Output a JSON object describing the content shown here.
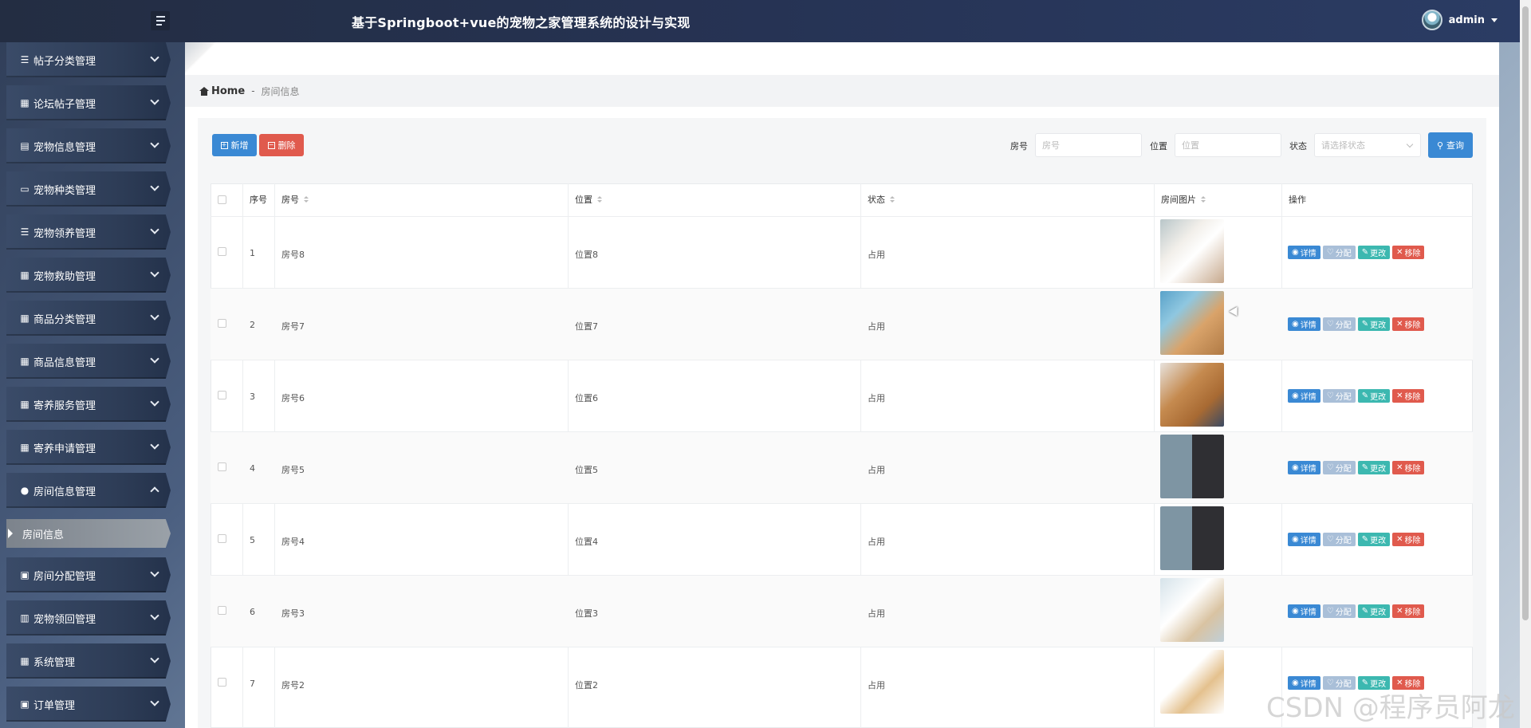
{
  "header": {
    "title": "基于Springboot+vue的宠物之家管理系统的设计与实现",
    "user": "admin"
  },
  "sidebar": {
    "items": [
      {
        "label": "帖子分类管理",
        "icon": "list-icon"
      },
      {
        "label": "论坛帖子管理",
        "icon": "grid-icon"
      },
      {
        "label": "宠物信息管理",
        "icon": "chat-icon"
      },
      {
        "label": "宠物种类管理",
        "icon": "monitor-icon"
      },
      {
        "label": "宠物领养管理",
        "icon": "list-icon"
      },
      {
        "label": "宠物救助管理",
        "icon": "grid-icon"
      },
      {
        "label": "商品分类管理",
        "icon": "grid-icon"
      },
      {
        "label": "商品信息管理",
        "icon": "grid-icon"
      },
      {
        "label": "寄养服务管理",
        "icon": "grid-icon"
      },
      {
        "label": "寄养申请管理",
        "icon": "grid-icon"
      },
      {
        "label": "房间信息管理",
        "icon": "user-icon"
      },
      {
        "label": "房间分配管理",
        "icon": "clipboard-icon"
      },
      {
        "label": "宠物领回管理",
        "icon": "chart-icon"
      },
      {
        "label": "系统管理",
        "icon": "grid-icon"
      },
      {
        "label": "订单管理",
        "icon": "clipboard-icon"
      }
    ],
    "active_sub": "房间信息"
  },
  "breadcrumb": {
    "home": "Home",
    "sep": "-",
    "current": "房间信息"
  },
  "toolbar": {
    "add_label": "新增",
    "delete_label": "删除",
    "search_label": "查询"
  },
  "filters": {
    "room_label": "房号",
    "room_placeholder": "房号",
    "location_label": "位置",
    "location_placeholder": "位置",
    "status_label": "状态",
    "status_placeholder": "请选择状态"
  },
  "table": {
    "columns": [
      "序号",
      "房号",
      "位置",
      "状态",
      "房间图片",
      "操作"
    ],
    "rows": [
      {
        "no": "1",
        "room": "房号8",
        "location": "位置8",
        "status": "占用",
        "image": "white-poodle-photo"
      },
      {
        "no": "2",
        "room": "房号7",
        "location": "位置7",
        "status": "占用",
        "image": "dog-grooming-photo"
      },
      {
        "no": "3",
        "room": "房号6",
        "location": "位置6",
        "status": "占用",
        "image": "brown-dog-photo"
      },
      {
        "no": "4",
        "room": "房号5",
        "location": "位置5",
        "status": "占用",
        "image": "poodle-collage-photo"
      },
      {
        "no": "5",
        "room": "房号4",
        "location": "位置4",
        "status": "占用",
        "image": "poodle-collage-photo"
      },
      {
        "no": "6",
        "room": "房号3",
        "location": "位置3",
        "status": "占用",
        "image": "vet-dog-photo"
      },
      {
        "no": "7",
        "room": "房号2",
        "location": "位置2",
        "status": "占用",
        "image": "puppy-stethoscope-photo"
      }
    ],
    "actions": {
      "detail": "详情",
      "assign": "分配",
      "edit": "更改",
      "remove": "移除"
    }
  },
  "watermark": "CSDN @程序员阿龙",
  "colors": {
    "header_bg": "#263354",
    "primary": "#3a89d4",
    "danger": "#e05a4d",
    "teal": "#3cb8b0",
    "muted_blue": "#a9bfd8"
  }
}
